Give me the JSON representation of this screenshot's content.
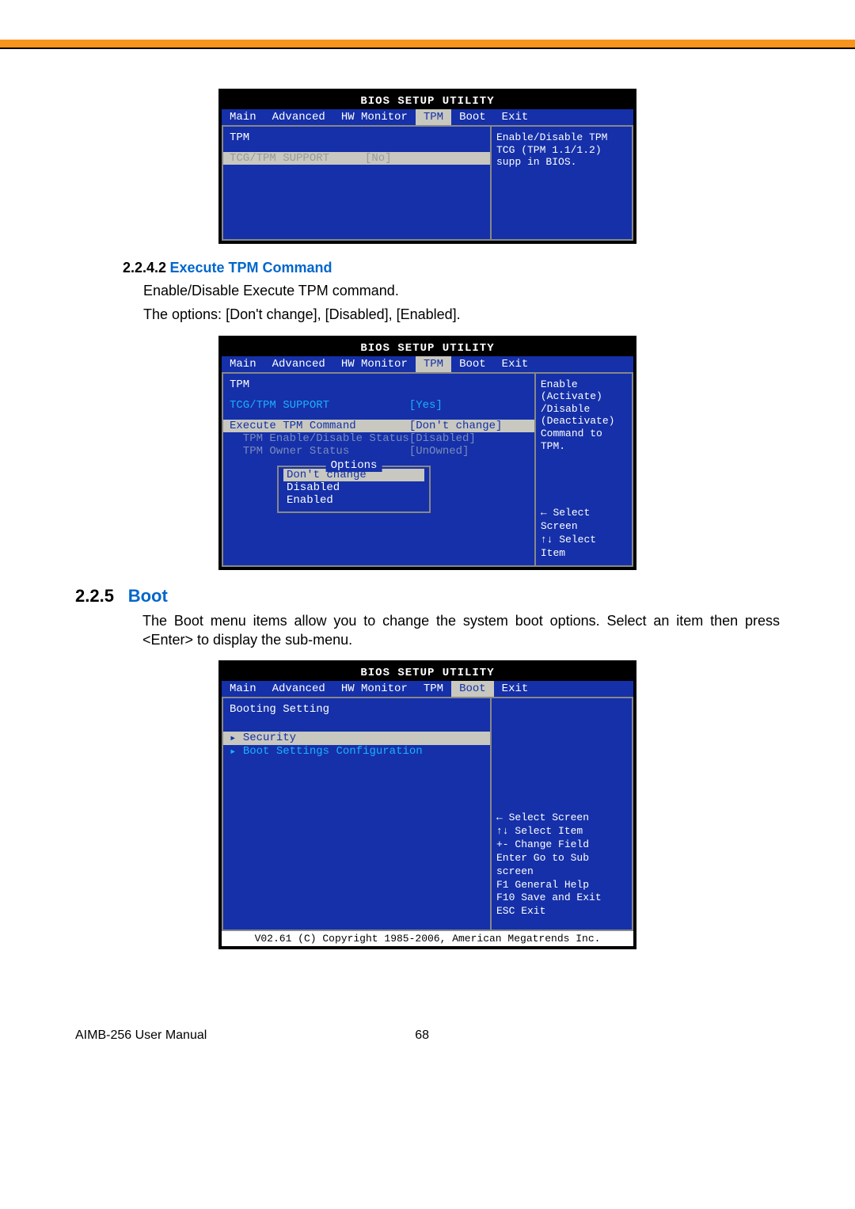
{
  "section242": {
    "num": "2.2.4.2",
    "title": "Execute TPM Command",
    "p1": "Enable/Disable Execute TPM command.",
    "p2": "The options: [Don't change], [Disabled], [Enabled]."
  },
  "section225": {
    "num": "2.2.5",
    "title": "Boot",
    "p1": "The Boot menu items allow you to change the system boot options. Select an item then press <Enter> to display the sub-menu."
  },
  "bios1": {
    "title": "BIOS SETUP UTILITY",
    "menu": [
      "Main",
      "Advanced",
      "HW Monitor",
      "TPM",
      "Boot",
      "Exit"
    ],
    "header": "TPM",
    "row1_label": "TCG/TPM SUPPORT",
    "row1_val": "[No]",
    "help": "Enable/Disable TPM TCG (TPM 1.1/1.2) supp in BIOS."
  },
  "bios2": {
    "title": "BIOS SETUP UTILITY",
    "menu": [
      "Main",
      "Advanced",
      "HW Monitor",
      "TPM",
      "Boot",
      "Exit"
    ],
    "header": "TPM",
    "row1_label": "TCG/TPM SUPPORT",
    "row1_val": "[Yes]",
    "row2_label": "Execute TPM Command",
    "row2_val": "[Don't change]",
    "row3_label": "  TPM Enable/Disable Status",
    "row3_val": "[Disabled]",
    "row4_label": "  TPM Owner Status",
    "row4_val": "[UnOwned]",
    "opt_title": "Options",
    "opt1": "Don't change",
    "opt2": "Disabled",
    "opt3": "Enabled",
    "help": "Enable (Activate) /Disable (Deactivate) Command to TPM.",
    "nav1": "← Select Screen",
    "nav2": "↑↓ Select Item"
  },
  "bios3": {
    "title": "BIOS SETUP UTILITY",
    "menu": [
      "Main",
      "Advanced",
      "HW Monitor",
      "TPM",
      "Boot",
      "Exit"
    ],
    "header": "Booting Setting",
    "row1_label": "Security",
    "row2_label": "Boot Settings Configuration",
    "nav1": "← Select Screen",
    "nav2": "↑↓ Select Item",
    "nav3": "+- Change Field",
    "nav4": "Enter Go to Sub screen",
    "nav5": "F1  General Help",
    "nav6": "F10 Save and Exit",
    "nav7": "ESC Exit",
    "copyright": "V02.61 (C) Copyright 1985-2006, American Megatrends Inc."
  },
  "footer": {
    "left": "AIMB-256 User Manual",
    "page": "68"
  }
}
